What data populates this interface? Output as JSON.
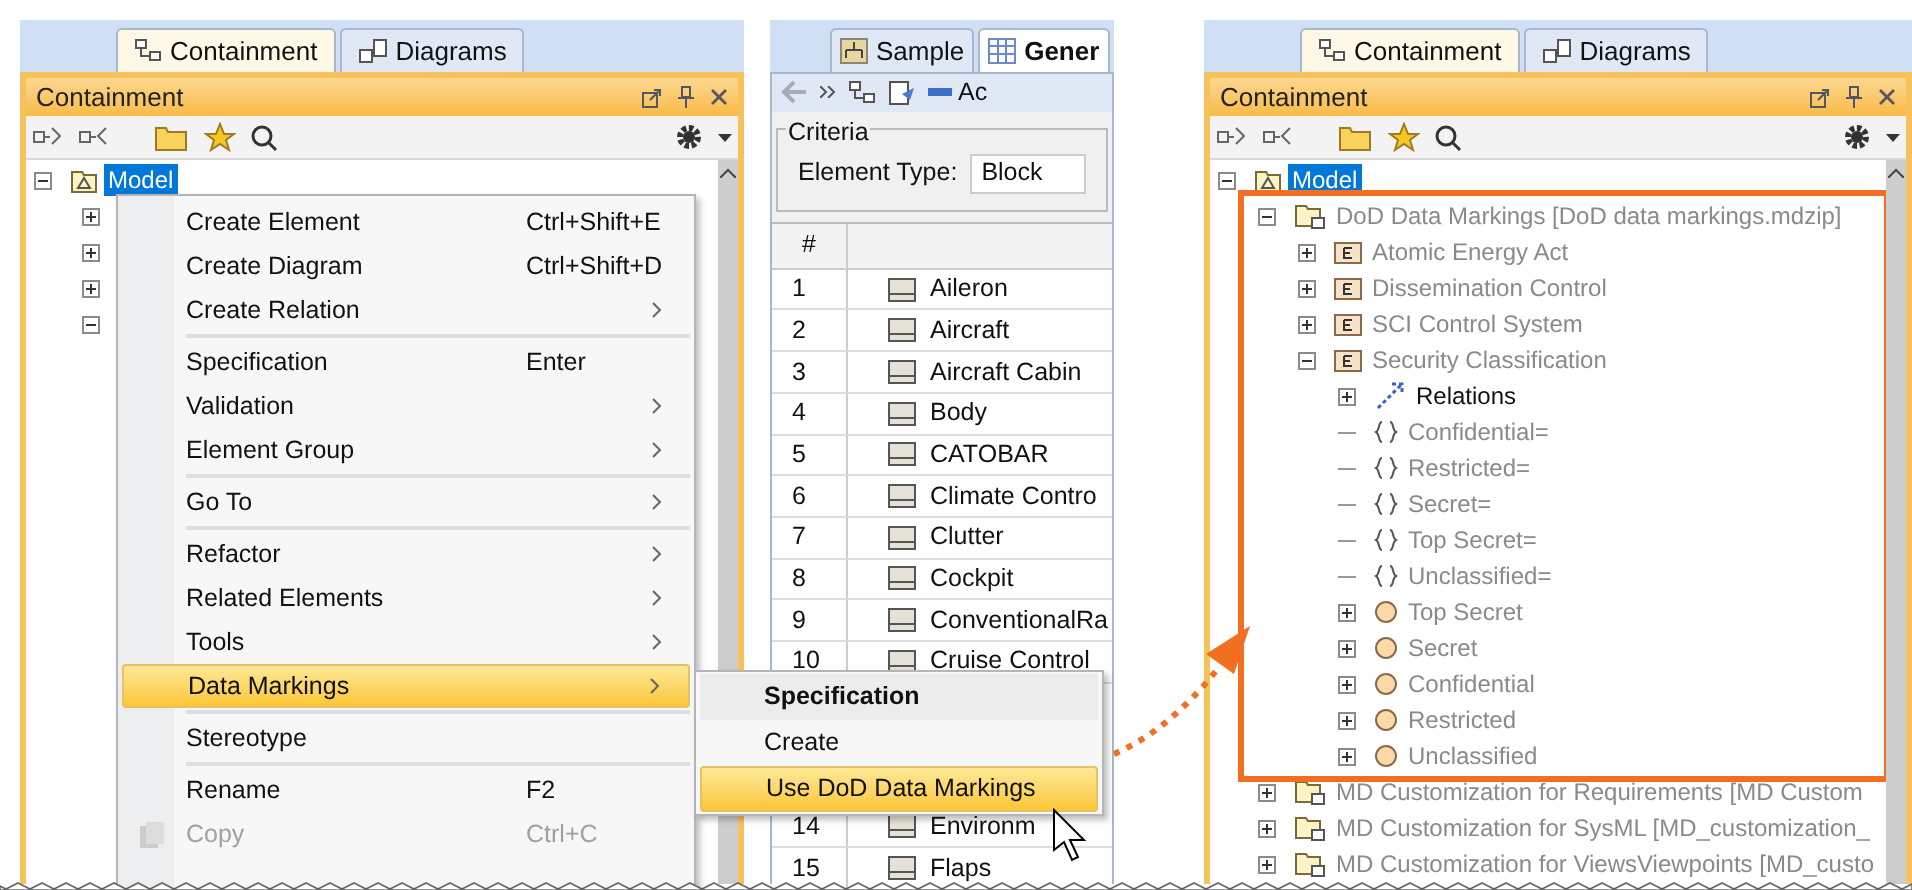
{
  "left_panel": {
    "tabs": [
      {
        "label": "Containment",
        "selected": true
      },
      {
        "label": "Diagrams",
        "selected": false
      }
    ],
    "title": "Containment",
    "tree": {
      "label": "Model",
      "kind": "model",
      "expanded": true,
      "selected": true
    },
    "hidden_rows": [
      {
        "expanded": false
      },
      {
        "expanded": false
      },
      {
        "expanded": false
      },
      {
        "expanded": true
      }
    ],
    "context_menu": [
      {
        "kind": "item",
        "label": "Create Element",
        "shortcut": "Ctrl+Shift+E",
        "submenu": false,
        "selected": false,
        "disabled": false
      },
      {
        "kind": "item",
        "label": "Create Diagram",
        "shortcut": "Ctrl+Shift+D",
        "submenu": false,
        "selected": false,
        "disabled": false
      },
      {
        "kind": "item",
        "label": "Create Relation",
        "submenu": true,
        "selected": false,
        "disabled": false
      },
      {
        "kind": "separator"
      },
      {
        "kind": "item",
        "label": "Specification",
        "shortcut": "Enter",
        "submenu": false,
        "selected": false,
        "disabled": false
      },
      {
        "kind": "item",
        "label": "Validation",
        "submenu": true,
        "selected": false,
        "disabled": false
      },
      {
        "kind": "item",
        "label": "Element Group",
        "submenu": true,
        "selected": false,
        "disabled": false
      },
      {
        "kind": "separator"
      },
      {
        "kind": "item",
        "label": "Go To",
        "submenu": true,
        "selected": false,
        "disabled": false
      },
      {
        "kind": "separator"
      },
      {
        "kind": "item",
        "label": "Refactor",
        "submenu": true,
        "selected": false,
        "disabled": false
      },
      {
        "kind": "item",
        "label": "Related Elements",
        "submenu": true,
        "selected": false,
        "disabled": false
      },
      {
        "kind": "item",
        "label": "Tools",
        "submenu": true,
        "selected": false,
        "disabled": false
      },
      {
        "kind": "item",
        "label": "Data Markings",
        "submenu": true,
        "selected": true,
        "disabled": false
      },
      {
        "kind": "separator"
      },
      {
        "kind": "item",
        "label": "Stereotype",
        "submenu": false,
        "selected": false,
        "disabled": false
      },
      {
        "kind": "separator"
      },
      {
        "kind": "item",
        "label": "Rename",
        "shortcut": "F2",
        "submenu": false,
        "selected": false,
        "disabled": false
      },
      {
        "kind": "item",
        "label": "Copy",
        "shortcut": "Ctrl+C",
        "submenu": false,
        "selected": false,
        "disabled": true,
        "icon": true
      }
    ],
    "submenu": [
      {
        "kind": "header",
        "label": "Specification",
        "selected": false
      },
      {
        "kind": "item",
        "label": "Create",
        "selected": false
      },
      {
        "kind": "item",
        "label": "Use DoD Data Markings",
        "selected": true
      }
    ]
  },
  "middle_panel": {
    "tabs": [
      {
        "label": "Sample",
        "selected": false
      },
      {
        "label": "Gener",
        "selected": true
      }
    ],
    "toolbar_label": "Ac",
    "criteria": {
      "legend": "Criteria",
      "label": "Element Type:",
      "value": "Block"
    },
    "table": {
      "columns": [
        "#"
      ],
      "rows": [
        {
          "number": "1",
          "name": "Aileron"
        },
        {
          "number": "2",
          "name": "Aircraft"
        },
        {
          "number": "3",
          "name": "Aircraft Cabin"
        },
        {
          "number": "4",
          "name": "Body"
        },
        {
          "number": "5",
          "name": "CATOBAR"
        },
        {
          "number": "6",
          "name": "Climate Contro"
        },
        {
          "number": "7",
          "name": "Clutter"
        },
        {
          "number": "8",
          "name": "Cockpit"
        },
        {
          "number": "9",
          "name": "ConventionalRa"
        },
        {
          "number": "10",
          "name": "Cruise Control"
        }
      ],
      "rows_below_menu": [
        {
          "number": "14",
          "name": "Environm"
        },
        {
          "number": "15",
          "name": "Flaps"
        }
      ]
    }
  },
  "right_panel": {
    "tabs": [
      {
        "label": "Containment",
        "selected": true
      },
      {
        "label": "Diagrams",
        "selected": false
      }
    ],
    "title": "Containment",
    "tree": {
      "label": "Model",
      "kind": "model",
      "expanded": true,
      "selected": true,
      "children": [
        {
          "label": "DoD Data Markings [DoD data markings.mdzip]",
          "kind": "package-usage",
          "expanded": true,
          "selected": false,
          "dimmed": true,
          "highlighted": true,
          "children": [
            {
              "label": "Atomic Energy Act",
              "kind": "enumeration",
              "expanded": false,
              "selected": false,
              "dimmed": true
            },
            {
              "label": "Dissemination Control",
              "kind": "enumeration",
              "expanded": false,
              "selected": false,
              "dimmed": true
            },
            {
              "label": "SCI Control System",
              "kind": "enumeration",
              "expanded": false,
              "selected": false,
              "dimmed": true
            },
            {
              "label": "Security Classification",
              "kind": "enumeration",
              "expanded": true,
              "selected": false,
              "dimmed": true,
              "children": [
                {
                  "label": "Relations",
                  "kind": "relations",
                  "expanded": false,
                  "selected": false,
                  "dimmed": false
                },
                {
                  "label": "Confidential=",
                  "kind": "slot",
                  "selected": false,
                  "dimmed": true
                },
                {
                  "label": "Restricted=",
                  "kind": "slot",
                  "selected": false,
                  "dimmed": true
                },
                {
                  "label": "Secret=",
                  "kind": "slot",
                  "selected": false,
                  "dimmed": true
                },
                {
                  "label": "Top Secret=",
                  "kind": "slot",
                  "selected": false,
                  "dimmed": true
                },
                {
                  "label": "Unclassified=",
                  "kind": "slot",
                  "selected": false,
                  "dimmed": true
                },
                {
                  "label": "Top Secret",
                  "kind": "instance",
                  "expanded": false,
                  "selected": false,
                  "dimmed": true
                },
                {
                  "label": "Secret",
                  "kind": "instance",
                  "expanded": false,
                  "selected": false,
                  "dimmed": true
                },
                {
                  "label": "Confidential",
                  "kind": "instance",
                  "expanded": false,
                  "selected": false,
                  "dimmed": true
                },
                {
                  "label": "Restricted",
                  "kind": "instance",
                  "expanded": false,
                  "selected": false,
                  "dimmed": true
                },
                {
                  "label": "Unclassified",
                  "kind": "instance",
                  "expanded": false,
                  "selected": false,
                  "dimmed": true
                }
              ]
            }
          ]
        },
        {
          "label": "MD Customization for Requirements [MD Custom",
          "kind": "package-usage",
          "expanded": false,
          "selected": false,
          "dimmed": true
        },
        {
          "label": "MD Customization for SysML [MD_customization_",
          "kind": "package-usage",
          "expanded": false,
          "selected": false,
          "dimmed": true
        },
        {
          "label": "MD Customization for ViewsViewpoints [MD_custo",
          "kind": "package-usage",
          "expanded": false,
          "selected": false,
          "dimmed": true
        }
      ]
    }
  }
}
